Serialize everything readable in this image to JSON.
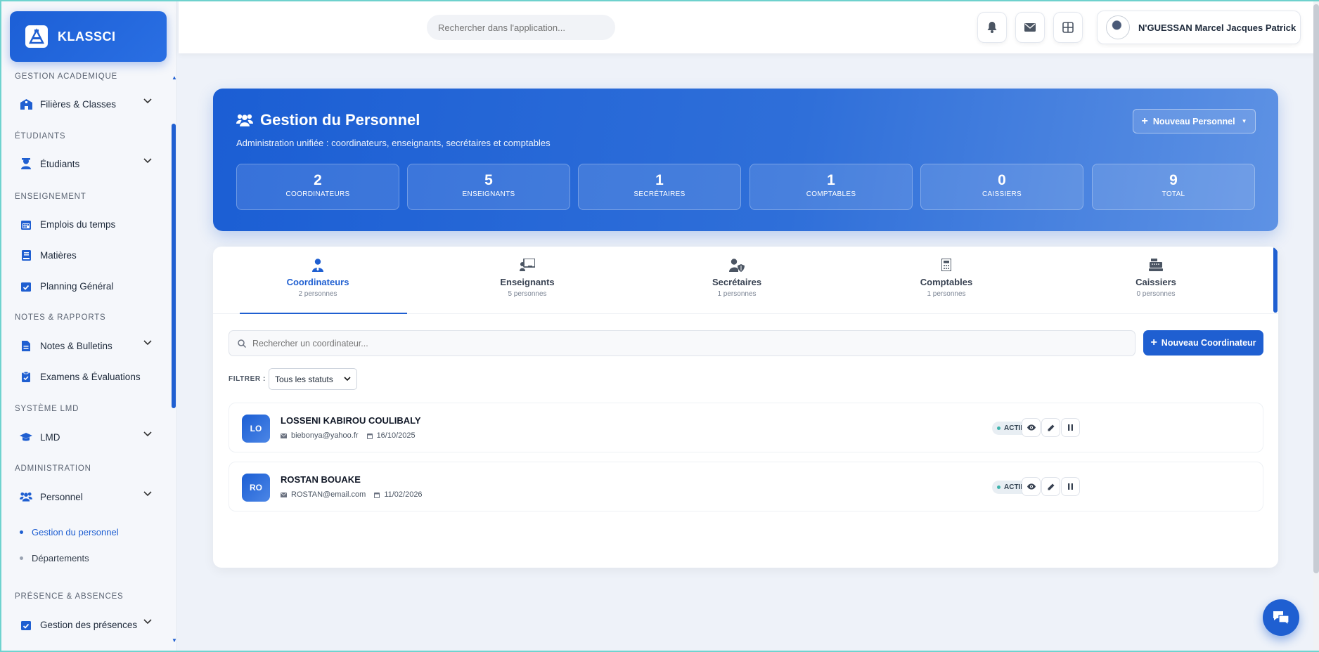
{
  "brand": {
    "name": "KLASSCI"
  },
  "sidebar": {
    "sections": [
      {
        "title": "GESTION ACADEMIQUE"
      },
      {
        "title": "ÉTUDIANTS"
      },
      {
        "title": "ENSEIGNEMENT"
      },
      {
        "title": "NOTES & RAPPORTS"
      },
      {
        "title": "SYSTÈME LMD"
      },
      {
        "title": "ADMINISTRATION"
      },
      {
        "title": "PRÉSENCE & ABSENCES"
      }
    ],
    "items": [
      {
        "label": "Filières & Classes",
        "icon": "school-icon"
      },
      {
        "label": "Étudiants",
        "icon": "student-icon"
      },
      {
        "label": "Emplois du temps",
        "icon": "calendar-icon"
      },
      {
        "label": "Matières",
        "icon": "book-icon"
      },
      {
        "label": "Planning Général",
        "icon": "calendar-check-icon"
      },
      {
        "label": "Notes & Bulletins",
        "icon": "file-icon"
      },
      {
        "label": "Examens & Évaluations",
        "icon": "clipboard-icon"
      },
      {
        "label": "LMD",
        "icon": "graduation-cap-icon"
      },
      {
        "label": "Personnel",
        "icon": "users-icon"
      },
      {
        "label": "Gestion des présences",
        "icon": "calendar-check-icon"
      }
    ],
    "sub_items": [
      {
        "label": "Gestion du personnel",
        "active": true
      },
      {
        "label": "Départements",
        "active": false
      }
    ]
  },
  "topbar": {
    "search_placeholder": "Rechercher dans l'application...",
    "icons": [
      "bell-icon",
      "mail-icon",
      "grid-icon"
    ],
    "user_name": "N'GUESSAN Marcel Jacques Patrick"
  },
  "hero": {
    "title": "Gestion du Personnel",
    "subtitle": "Administration unifiée : coordinateurs, enseignants, secrétaires et comptables",
    "new_button": "Nouveau Personnel",
    "stats": [
      {
        "value": "2",
        "label": "COORDINATEURS"
      },
      {
        "value": "5",
        "label": "ENSEIGNANTS"
      },
      {
        "value": "1",
        "label": "SECRÉTAIRES"
      },
      {
        "value": "1",
        "label": "COMPTABLES"
      },
      {
        "value": "0",
        "label": "CAISSIERS"
      },
      {
        "value": "9",
        "label": "TOTAL"
      }
    ]
  },
  "tabs": [
    {
      "label": "Coordinateurs",
      "count": "2 personnes",
      "icon": "user-tie-icon",
      "active": true
    },
    {
      "label": "Enseignants",
      "count": "5 personnes",
      "icon": "chalkboard-teacher-icon",
      "active": false
    },
    {
      "label": "Secrétaires",
      "count": "1 personnes",
      "icon": "user-shield-icon",
      "active": false
    },
    {
      "label": "Comptables",
      "count": "1 personnes",
      "icon": "calculator-icon",
      "active": false
    },
    {
      "label": "Caissiers",
      "count": "0 personnes",
      "icon": "cash-register-icon",
      "active": false
    }
  ],
  "list": {
    "search_placeholder": "Rechercher un coordinateur...",
    "new_button": "Nouveau Coordinateur",
    "filter_label": "FILTRER :",
    "filter_value": "Tous les statuts",
    "people": [
      {
        "initials": "LO",
        "name": "LOSSENI KABIROU COULIBALY",
        "email": "biebonya@yahoo.fr",
        "date": "16/10/2025",
        "status": "ACTIF"
      },
      {
        "initials": "RO",
        "name": "ROSTAN BOUAKE",
        "email": "ROSTAN@email.com",
        "date": "11/02/2026",
        "status": "ACTIF"
      }
    ]
  },
  "colors": {
    "primary": "#1f5fd1",
    "status_dot": "#3fb3ac"
  }
}
